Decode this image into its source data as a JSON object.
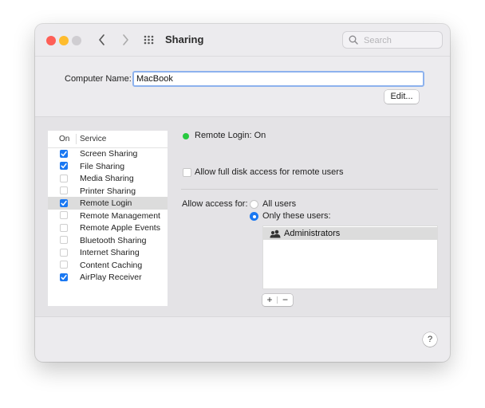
{
  "window": {
    "title": "Sharing"
  },
  "search": {
    "placeholder": "Search",
    "value": ""
  },
  "computer_name": {
    "label": "Computer Name:",
    "value": "MacBook",
    "edit_label": "Edit..."
  },
  "services": {
    "header_on": "On",
    "header_service": "Service",
    "items": [
      {
        "name": "Screen Sharing",
        "on": true
      },
      {
        "name": "File Sharing",
        "on": true
      },
      {
        "name": "Media Sharing",
        "on": false
      },
      {
        "name": "Printer Sharing",
        "on": false
      },
      {
        "name": "Remote Login",
        "on": true,
        "selected": true
      },
      {
        "name": "Remote Management",
        "on": false
      },
      {
        "name": "Remote Apple Events",
        "on": false
      },
      {
        "name": "Bluetooth Sharing",
        "on": false
      },
      {
        "name": "Internet Sharing",
        "on": false
      },
      {
        "name": "Content Caching",
        "on": false
      },
      {
        "name": "AirPlay Receiver",
        "on": true
      }
    ]
  },
  "detail": {
    "status": "Remote Login: On",
    "status_color": "#27c93f",
    "full_disk_label": "Allow full disk access for remote users",
    "full_disk_checked": false,
    "access_label": "Allow access for:",
    "access_all_label": "All users",
    "access_only_label": "Only these users:",
    "access_selected": "Only these users:",
    "users": [
      {
        "name": "Administrators",
        "icon": "group-icon"
      }
    ],
    "add_label": "+",
    "remove_label": "−"
  },
  "help": {
    "label": "?"
  },
  "colors": {
    "accent": "#1a78f2",
    "close": "#fe5f57",
    "minimize": "#febc2e"
  }
}
